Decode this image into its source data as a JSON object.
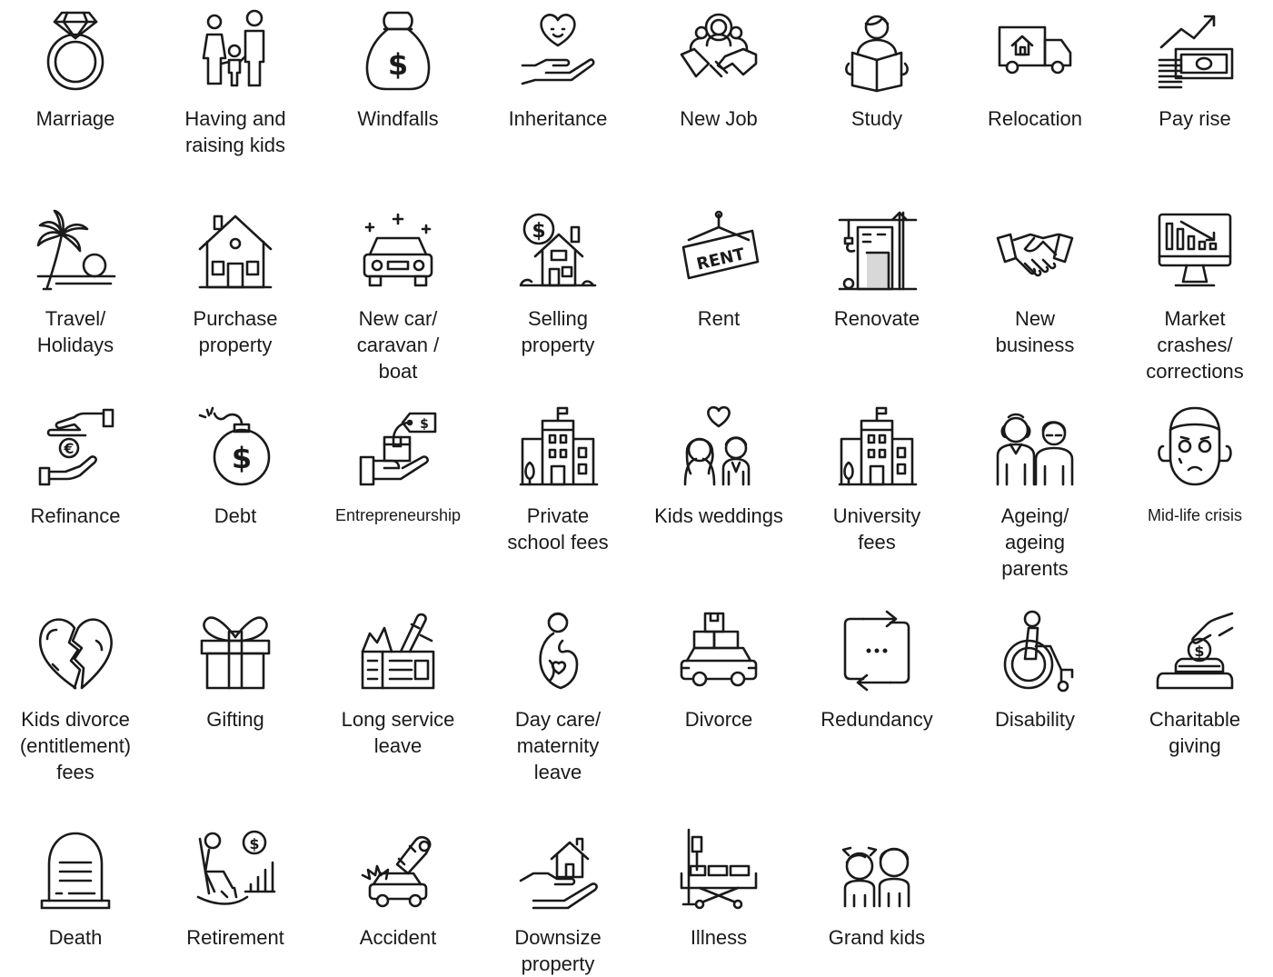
{
  "items": [
    {
      "label": "Marriage",
      "icon": "ring-icon"
    },
    {
      "label": "Having and\nraising kids",
      "icon": "family-icon"
    },
    {
      "label": "Windfalls",
      "icon": "money-bag-icon"
    },
    {
      "label": "Inheritance",
      "icon": "heart-hand-icon"
    },
    {
      "label": "New Job",
      "icon": "team-handshake-icon"
    },
    {
      "label": "Study",
      "icon": "student-book-icon"
    },
    {
      "label": "Relocation",
      "icon": "moving-truck-icon"
    },
    {
      "label": "Pay rise",
      "icon": "money-growth-icon"
    },
    {
      "label": "Travel/\nHolidays",
      "icon": "palm-beach-icon"
    },
    {
      "label": "Purchase\nproperty",
      "icon": "house-icon"
    },
    {
      "label": "New car/\ncaravan /\nboat",
      "icon": "car-icon"
    },
    {
      "label": "Selling\nproperty",
      "icon": "house-dollar-icon"
    },
    {
      "label": "Rent",
      "icon": "rent-sign-icon"
    },
    {
      "label": "Renovate",
      "icon": "construction-crane-icon"
    },
    {
      "label": "New\nbusiness",
      "icon": "handshake-icon"
    },
    {
      "label": "Market\ncrashes/\ncorrections",
      "icon": "monitor-chart-down-icon"
    },
    {
      "label": "Refinance",
      "icon": "euro-exchange-icon"
    },
    {
      "label": "Debt",
      "icon": "bomb-dollar-icon"
    },
    {
      "label": "Entrepreneurship",
      "icon": "hand-box-tag-icon"
    },
    {
      "label": "Private\nschool fees",
      "icon": "school-building-icon"
    },
    {
      "label": "Kids weddings",
      "icon": "wedding-couple-icon"
    },
    {
      "label": "University\nfees",
      "icon": "university-building-icon"
    },
    {
      "label": "Ageing/\nageing\nparents",
      "icon": "elderly-couple-icon"
    },
    {
      "label": "Mid-life crisis",
      "icon": "worried-man-icon"
    },
    {
      "label": "Kids divorce\n(entitlement)\nfees",
      "icon": "broken-heart-icon"
    },
    {
      "label": "Gifting",
      "icon": "gift-box-icon"
    },
    {
      "label": "Long service\nleave",
      "icon": "ticket-plane-icon"
    },
    {
      "label": "Day care/\nmaternity\nleave",
      "icon": "pregnant-woman-icon"
    },
    {
      "label": "Divorce",
      "icon": "car-with-boxes-icon"
    },
    {
      "label": "Redundancy",
      "icon": "repeat-arrows-icon"
    },
    {
      "label": "Disability",
      "icon": "wheelchair-icon"
    },
    {
      "label": "Charitable\ngiving",
      "icon": "donation-hand-icon"
    },
    {
      "label": "Death",
      "icon": "gravestone-icon"
    },
    {
      "label": "Retirement",
      "icon": "rocking-chair-icon"
    },
    {
      "label": "Accident",
      "icon": "car-crash-icon"
    },
    {
      "label": "Downsize\nproperty",
      "icon": "house-in-hand-icon"
    },
    {
      "label": "Illness",
      "icon": "hospital-bed-icon"
    },
    {
      "label": "Grand kids",
      "icon": "children-icon"
    }
  ],
  "icon_text": {
    "rent_sign": "RENT",
    "dollar": "$",
    "euro": "€"
  },
  "colors": {
    "ink": "#1a1a1a",
    "background": "#ffffff"
  }
}
